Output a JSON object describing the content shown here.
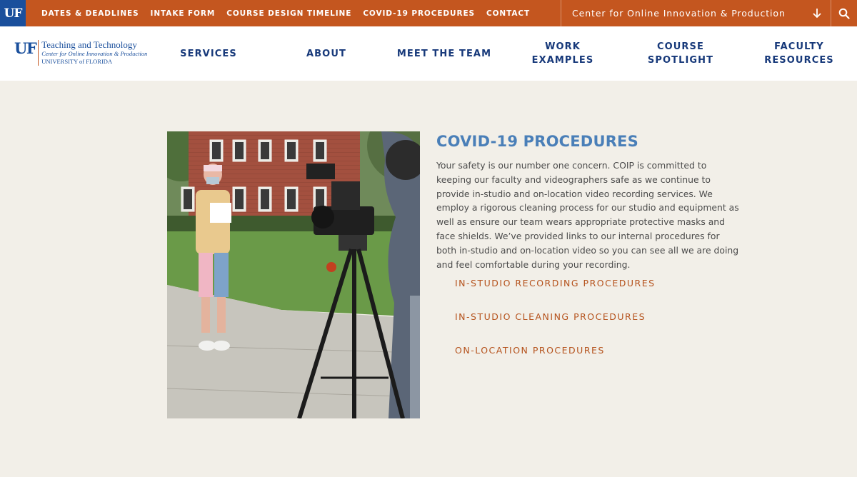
{
  "topbar": {
    "logo": "UF",
    "links": [
      "DATES & DEADLINES",
      "INTAKE FORM",
      "COURSE DESIGN TIMELINE",
      "COVID-19 PROCEDURES",
      "CONTACT"
    ],
    "center_select": "Center for Online Innovation & Production",
    "colors": {
      "bar": "#c4561f",
      "logo_bg": "#1a4f9c"
    },
    "icons": {
      "dropdown": "arrow-down-icon",
      "search": "search-icon"
    }
  },
  "header": {
    "logo": {
      "mark": "UF",
      "line1": "Teaching and Technology",
      "line2": "Center for Online Innovation & Production",
      "line3": "UNIVERSITY of FLORIDA"
    },
    "nav": [
      "SERVICES",
      "ABOUT",
      "MEET THE TEAM",
      "WORK EXAMPLES",
      "COURSE\nSPOTLIGHT",
      "FACULTY\nRESOURCES"
    ]
  },
  "main": {
    "title": "COVID-19 PROCEDURES",
    "body": "Your safety is our number one concern. COIP is committed to keeping our faculty and videographers safe as we continue to provide in-studio and on-location video recording services. We employ a rigorous cleaning process for our studio and equipment as well as ensure our team wears appropriate protective masks and face shields. We’ve provided links to our internal procedures for both in-studio and on-location video so you can see all we are doing and feel comfortable during your recording.",
    "links": [
      "IN-STUDIO RECORDING PROCEDURES",
      "IN-STUDIO CLEANING PROCEDURES",
      "ON-LOCATION PROCEDURES"
    ],
    "colors": {
      "title": "#4a7fb8",
      "link": "#b5521c",
      "nav": "#17397a"
    }
  }
}
